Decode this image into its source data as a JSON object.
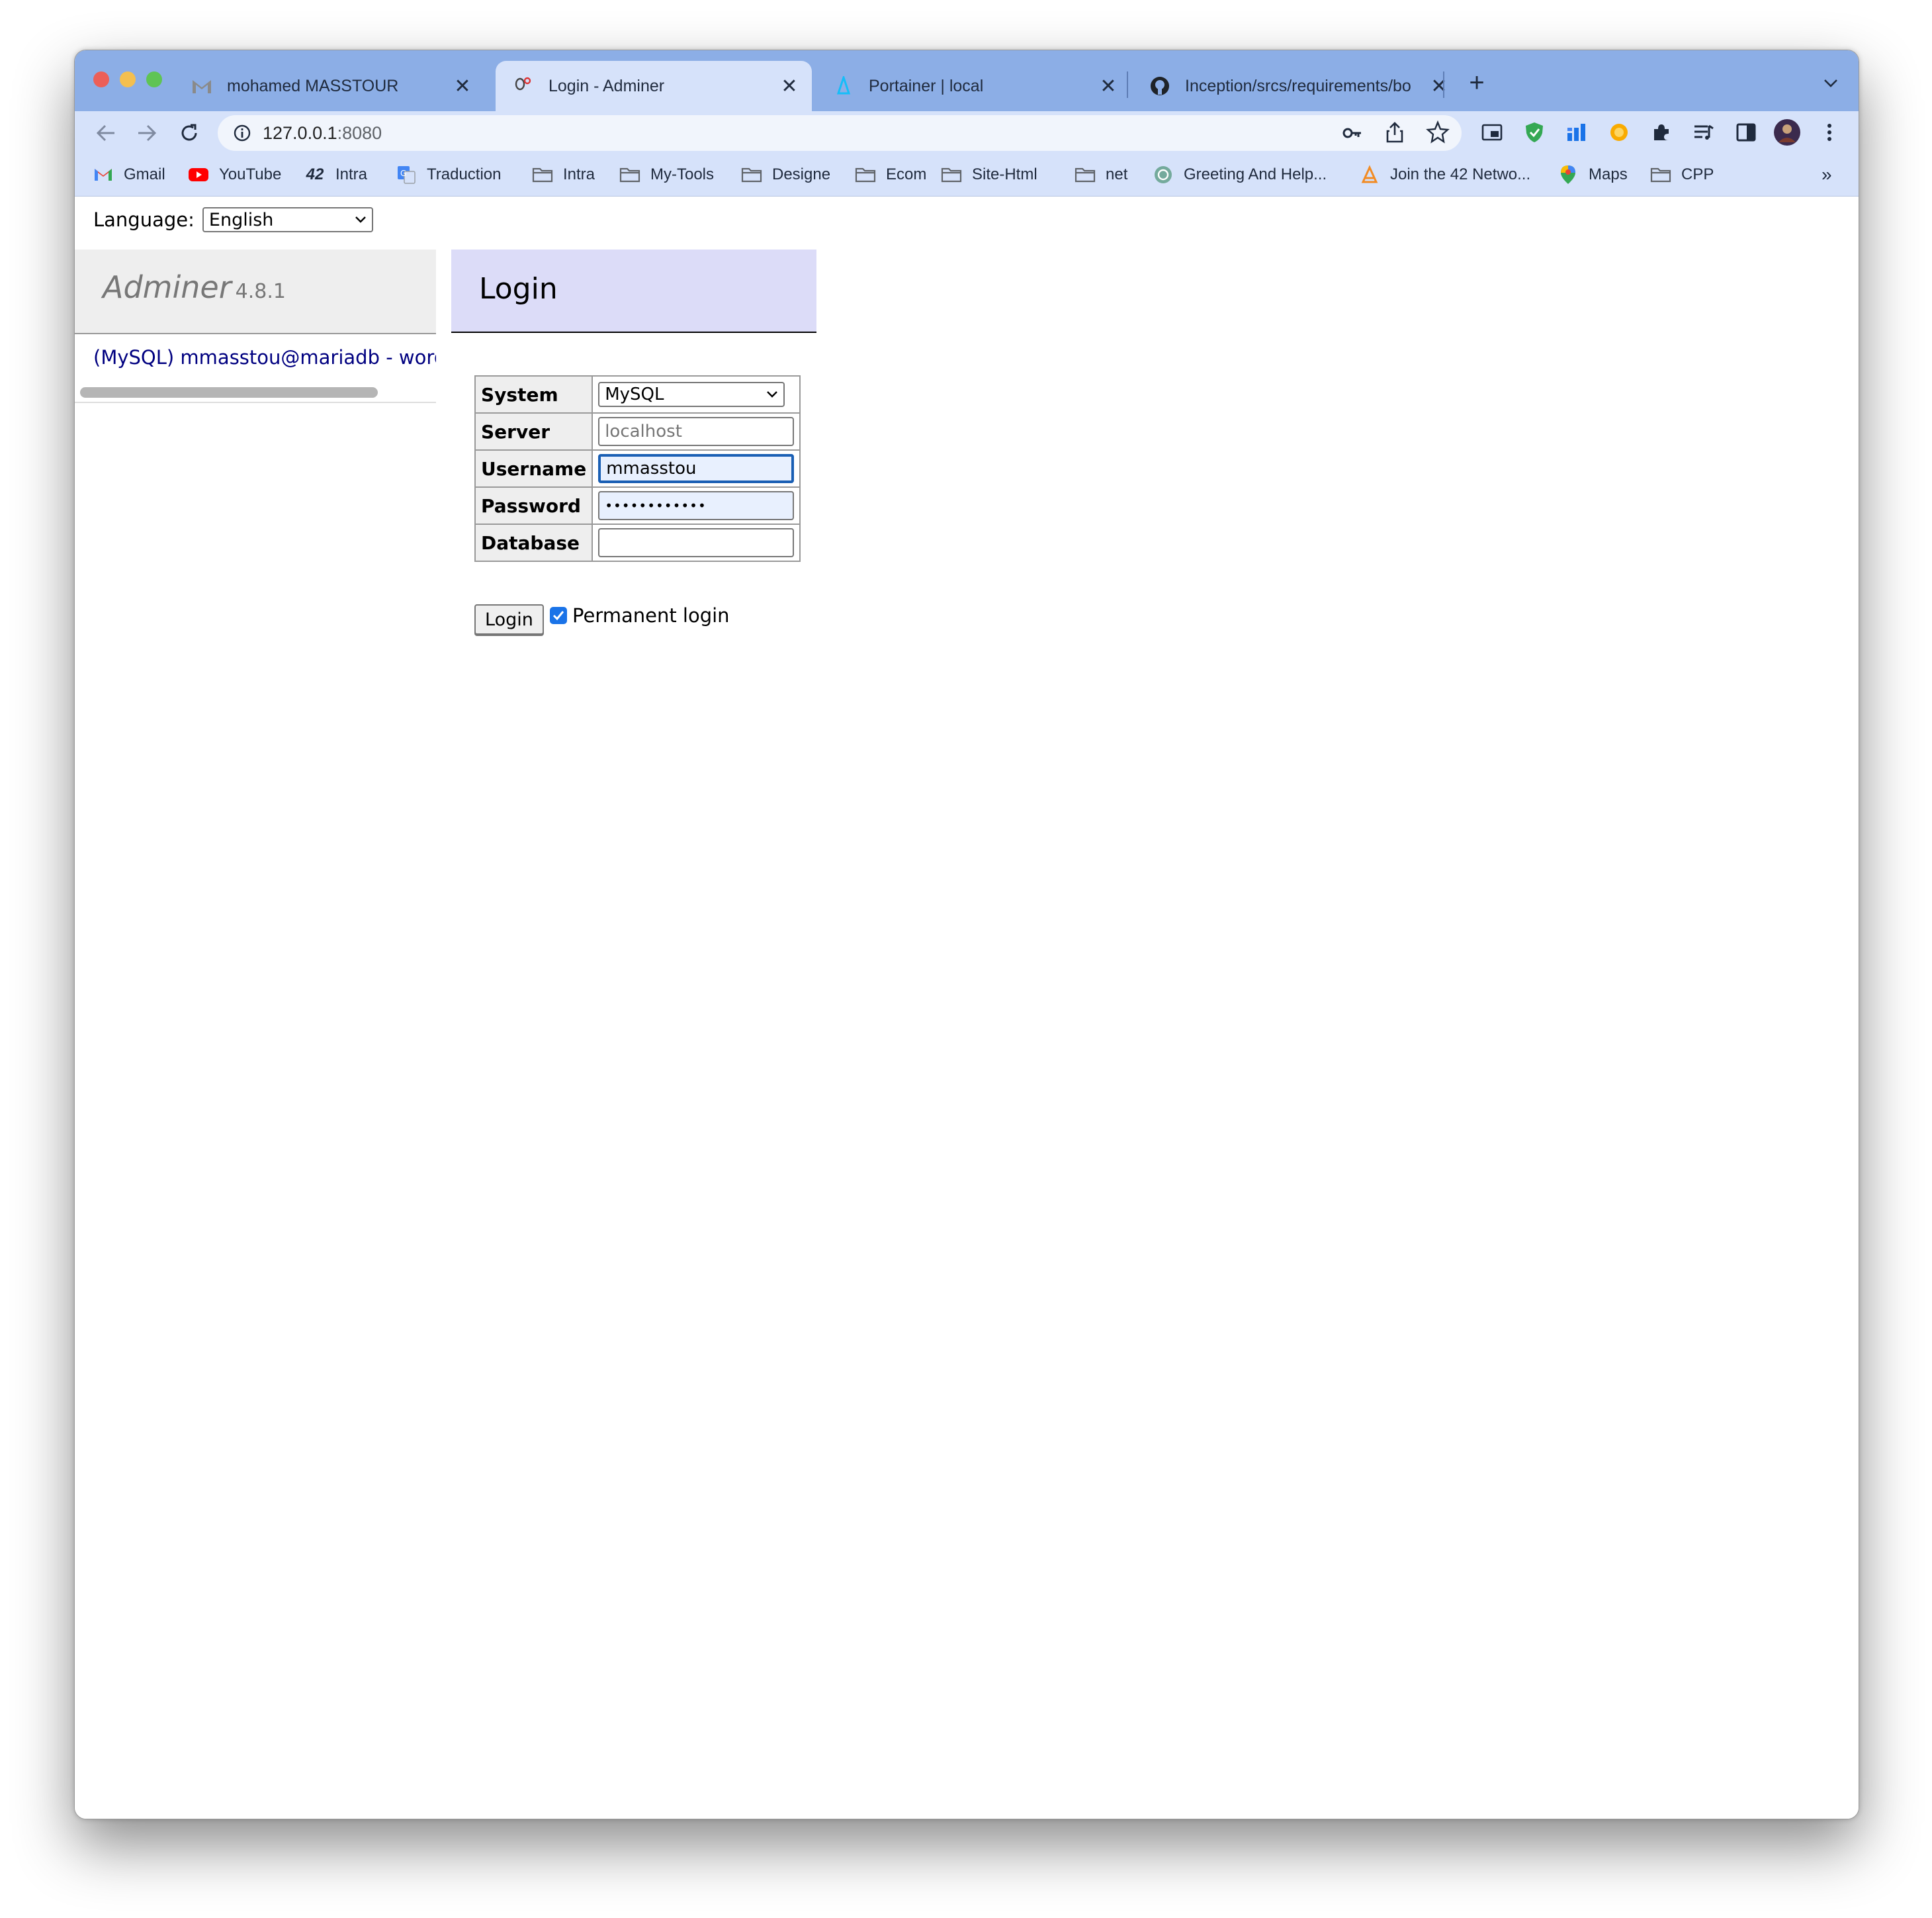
{
  "browser": {
    "tabs": [
      {
        "title": "mohamed MASSTOUR",
        "icon": "gmail-icon"
      },
      {
        "title": "Login - Adminer",
        "icon": "adminer-icon"
      },
      {
        "title": "Portainer | local",
        "icon": "portainer-icon"
      },
      {
        "title": "Inception/srcs/requirements/bo",
        "icon": "github-icon"
      }
    ],
    "active_tab": 1,
    "url_host": "127.0.0.1",
    "url_port": ":8080",
    "bookmarks": [
      {
        "label": "Gmail",
        "icon": "gmail-icon"
      },
      {
        "label": "YouTube",
        "icon": "youtube-icon"
      },
      {
        "label": "Intra",
        "icon": "42-icon"
      },
      {
        "label": "Traduction",
        "icon": "translate-icon"
      },
      {
        "label": "Intra",
        "icon": "folder-icon"
      },
      {
        "label": "My-Tools",
        "icon": "folder-icon"
      },
      {
        "label": "Designe",
        "icon": "folder-icon"
      },
      {
        "label": "Ecom",
        "icon": "folder-icon"
      },
      {
        "label": "Site-Html",
        "icon": "folder-icon"
      },
      {
        "label": "net",
        "icon": "folder-icon"
      },
      {
        "label": "Greeting And Help...",
        "icon": "openai-icon"
      },
      {
        "label": "Join the 42 Netwo...",
        "icon": "site-icon"
      },
      {
        "label": "Maps",
        "icon": "maps-icon"
      },
      {
        "label": "CPP",
        "icon": "folder-icon"
      }
    ],
    "overflow": "»"
  },
  "page": {
    "language_label": "Language:",
    "language_value": "English",
    "brand": "Adminer",
    "version": "4.8.1",
    "saved_login": "(MySQL) mmasstou@mariadb - wordpress",
    "heading": "Login",
    "form": {
      "system_label": "System",
      "system_value": "MySQL",
      "server_label": "Server",
      "server_placeholder": "localhost",
      "username_label": "Username",
      "username_value": "mmasstou",
      "password_label": "Password",
      "password_value": "••••••••••••",
      "database_label": "Database",
      "database_value": ""
    },
    "login_button": "Login",
    "permanent_label": "Permanent login",
    "permanent_checked": true
  },
  "colors": {
    "tabstrip": "#8caee6",
    "toolbar": "#d6e2fa",
    "heading_bg": "#dcdcf8",
    "link": "#000080"
  }
}
